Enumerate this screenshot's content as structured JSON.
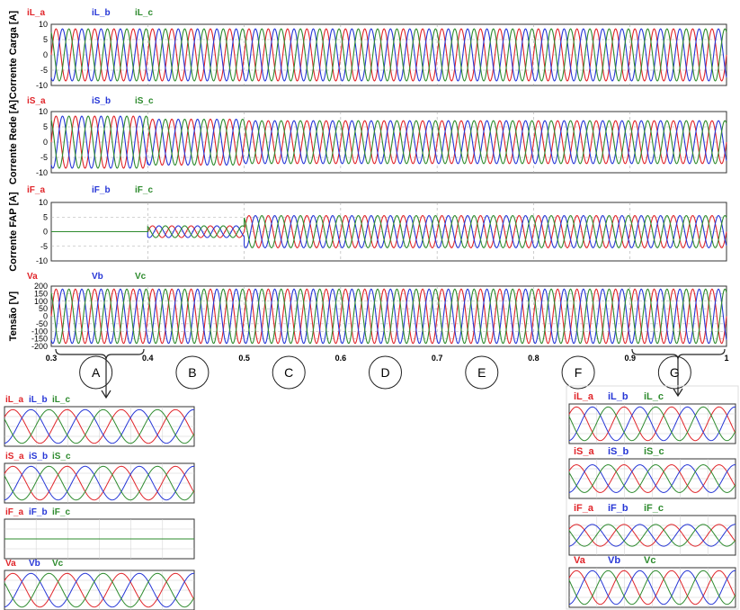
{
  "colors": {
    "phase_a": "#e0252a",
    "phase_b": "#2636d6",
    "phase_c": "#2e8b2e",
    "frame": "#333333",
    "grid": "#aaaaaa"
  },
  "chart_data": [
    {
      "type": "line",
      "ylabel": "Corrente Carga [A]",
      "legend": [
        "iL_a",
        "iL_b",
        "iL_c"
      ],
      "ylim": [
        -10,
        10
      ],
      "yticks": [
        "10",
        "5",
        "0",
        "-5",
        "-10"
      ],
      "xlim": [
        0.3,
        1.0
      ],
      "segments": [
        {
          "t_start": 0.3,
          "t_end": 1.0,
          "amplitude": 8.5
        }
      ]
    },
    {
      "type": "line",
      "ylabel": "Corrente Rede [A]",
      "legend": [
        "iS_a",
        "iS_b",
        "iS_c"
      ],
      "ylim": [
        -10,
        10
      ],
      "yticks": [
        "10",
        "5",
        "0",
        "-5",
        "-10"
      ],
      "xlim": [
        0.3,
        1.0
      ],
      "segments": [
        {
          "t_start": 0.3,
          "t_end": 0.4,
          "amplitude": 8.5
        },
        {
          "t_start": 0.4,
          "t_end": 0.5,
          "amplitude": 7.5
        },
        {
          "t_start": 0.5,
          "t_end": 1.0,
          "amplitude": 7.0
        }
      ]
    },
    {
      "type": "line",
      "ylabel": "Corrente FAP [A]",
      "legend": [
        "iF_a",
        "iF_b",
        "iF_c"
      ],
      "ylim": [
        -10,
        10
      ],
      "yticks": [
        "10",
        "5",
        "0",
        "-5",
        "-10"
      ],
      "xlim": [
        0.3,
        1.0
      ],
      "segments": [
        {
          "t_start": 0.3,
          "t_end": 0.4,
          "amplitude": 0
        },
        {
          "t_start": 0.4,
          "t_end": 0.5,
          "amplitude": 2.0
        },
        {
          "t_start": 0.5,
          "t_end": 1.0,
          "amplitude": 5.5
        }
      ]
    },
    {
      "type": "line",
      "ylabel": "Tensão [V]",
      "legend": [
        "Va",
        "Vb",
        "Vc"
      ],
      "ylim": [
        -200,
        200
      ],
      "yticks": [
        "200",
        "150",
        "100",
        "50",
        "0",
        "-50",
        "-100",
        "-150",
        "-200"
      ],
      "xlim": [
        0.3,
        1.0
      ],
      "segments": [
        {
          "t_start": 0.3,
          "t_end": 1.0,
          "amplitude": 180
        }
      ]
    }
  ],
  "x_ticks": [
    "0.3",
    "0.4",
    "0.5",
    "0.6",
    "0.7",
    "0.8",
    "0.9",
    "1"
  ],
  "x_tick_values": [
    0.3,
    0.4,
    0.5,
    0.6,
    0.7,
    0.8,
    0.9,
    1.0
  ],
  "periods": {
    "labels": [
      "A",
      "B",
      "C",
      "D",
      "E",
      "F",
      "G"
    ],
    "centers": [
      0.35,
      0.45,
      0.55,
      0.65,
      0.75,
      0.85,
      0.95
    ]
  },
  "zoom_left": {
    "from_period": "A",
    "panels": [
      {
        "legend": [
          "iL_a",
          "iL_b",
          "iL_c"
        ],
        "amplitude": 0.85
      },
      {
        "legend": [
          "iS_a",
          "iS_b",
          "iS_c"
        ],
        "amplitude": 0.85
      },
      {
        "legend": [
          "iF_a",
          "iF_b",
          "iF_c"
        ],
        "amplitude": 0.0
      },
      {
        "legend": [
          "Va",
          "Vb",
          "Vc"
        ],
        "amplitude": 0.85
      }
    ]
  },
  "zoom_right": {
    "from_period": "G",
    "panels": [
      {
        "legend": [
          "iL_a",
          "iL_b",
          "iL_c"
        ],
        "amplitude": 0.85
      },
      {
        "legend": [
          "iS_a",
          "iS_b",
          "iS_c"
        ],
        "amplitude": 0.7
      },
      {
        "legend": [
          "iF_a",
          "iF_b",
          "iF_c"
        ],
        "amplitude": 0.55
      },
      {
        "legend": [
          "Va",
          "Vb",
          "Vc"
        ],
        "amplitude": 0.85
      }
    ]
  }
}
